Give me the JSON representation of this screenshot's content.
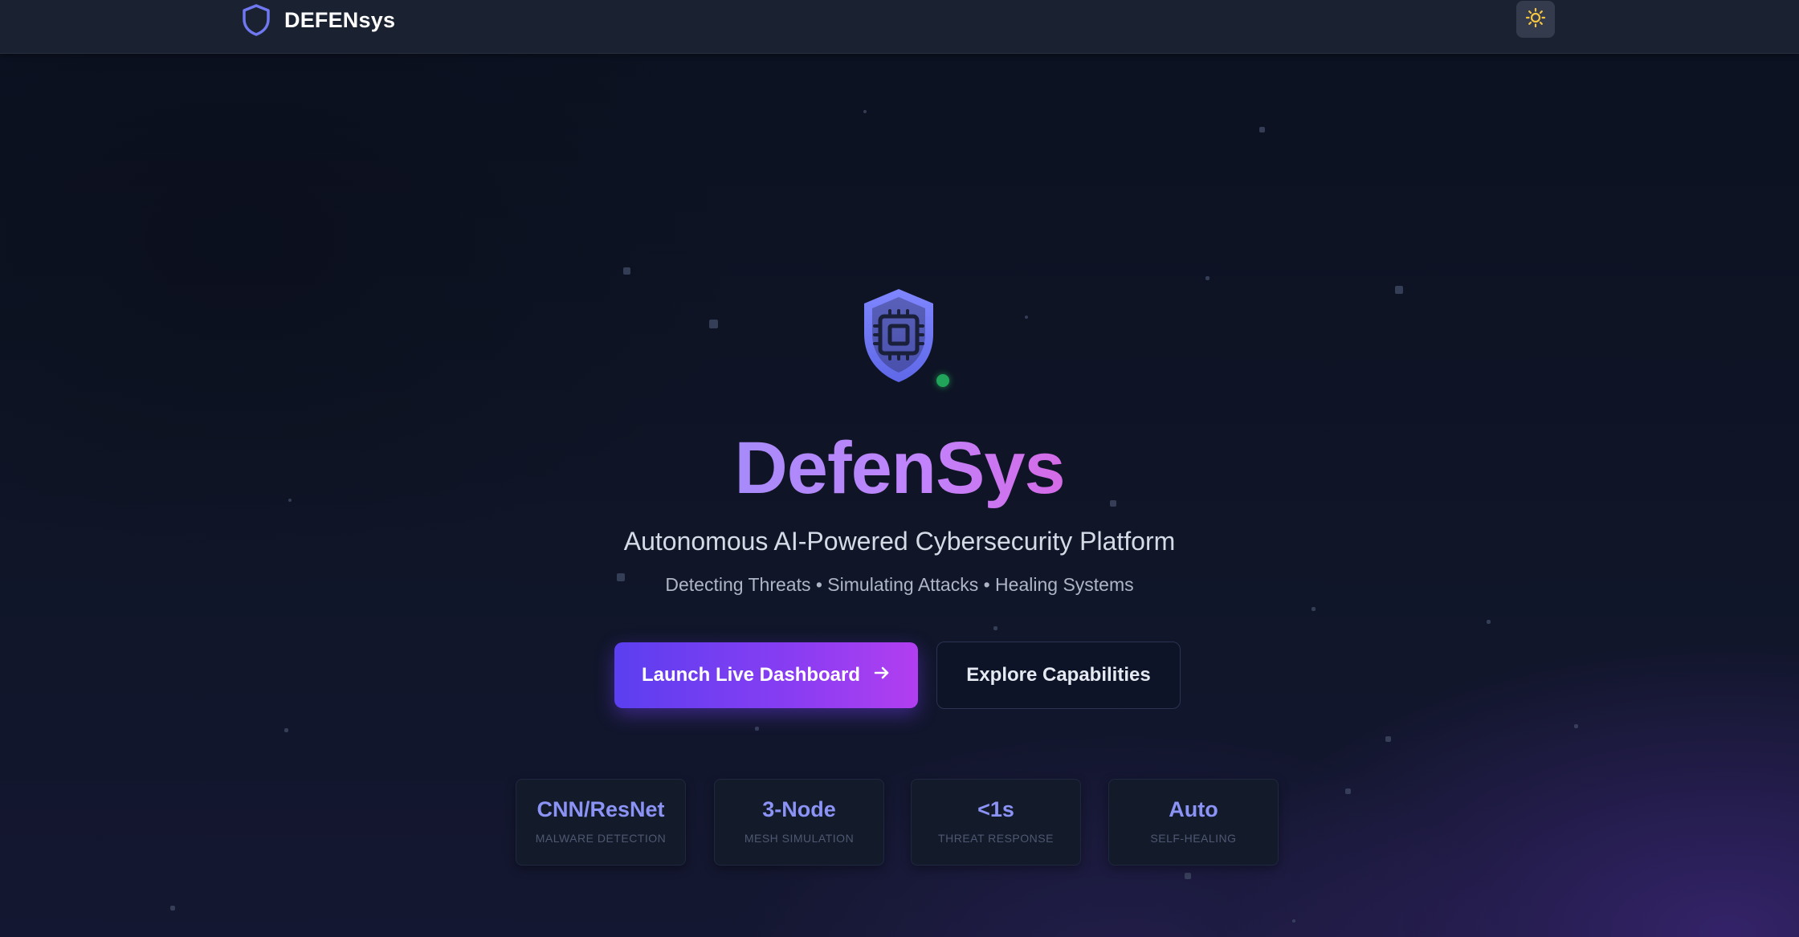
{
  "navbar": {
    "brand_name": "DEFENsys",
    "brand_icon": "shield-icon",
    "theme_toggle_icon": "sun-icon"
  },
  "hero": {
    "emblem_icon": "shield-chip-icon",
    "status_color": "#22a35a",
    "title": "DefenSys",
    "subtitle": "Autonomous AI-Powered Cybersecurity Platform",
    "tagline": "Detecting Threats • Simulating Attacks • Healing Systems",
    "primary_button": {
      "label": "Launch Live Dashboard",
      "icon": "arrow-right-icon"
    },
    "secondary_button": {
      "label": "Explore Capabilities"
    }
  },
  "stats": [
    {
      "value": "CNN/ResNet",
      "label": "MALWARE DETECTION"
    },
    {
      "value": "3-Node",
      "label": "MESH SIMULATION"
    },
    {
      "value": "<1s",
      "label": "THREAT RESPONSE"
    },
    {
      "value": "Auto",
      "label": "SELF-HEALING"
    }
  ],
  "colors": {
    "accent": "#8b93f5",
    "gradient_start": "#5b3ff0",
    "gradient_end": "#b23ef0",
    "background": "#0b1120"
  }
}
